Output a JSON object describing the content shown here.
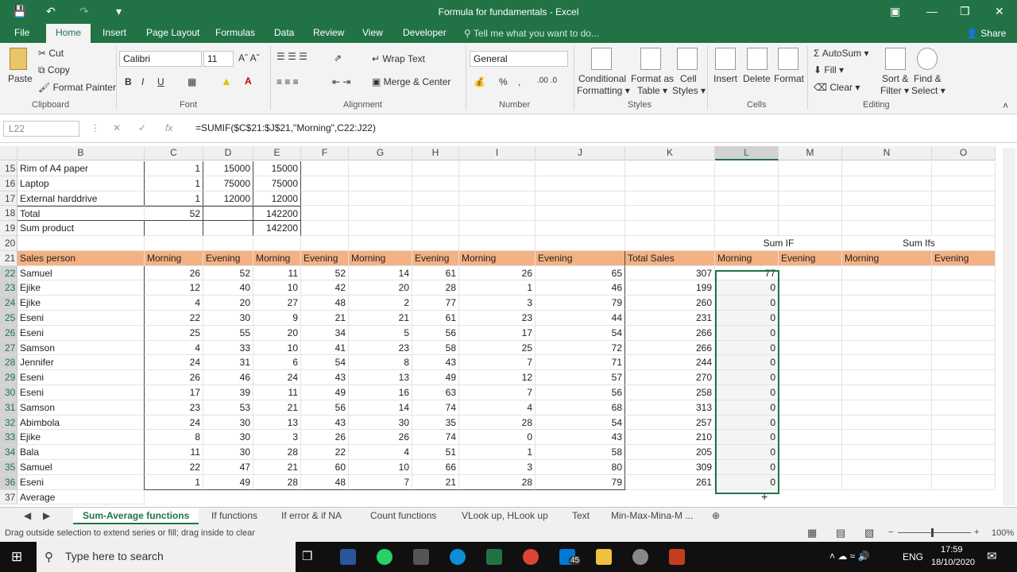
{
  "window": {
    "title": "Formula for fundamentals - Excel"
  },
  "ribbon_tabs": [
    "File",
    "Home",
    "Insert",
    "Page Layout",
    "Formulas",
    "Data",
    "Review",
    "View",
    "Developer"
  ],
  "active_tab": "Home",
  "tellme": "Tell me what you want to do...",
  "share": "Share",
  "clipboard": {
    "paste": "Paste",
    "cut": "Cut",
    "copy": "Copy",
    "format_painter": "Format Painter",
    "label": "Clipboard"
  },
  "font": {
    "name": "Calibri",
    "size": "11",
    "label": "Font"
  },
  "alignment": {
    "wrap": "Wrap Text",
    "merge": "Merge & Center",
    "label": "Alignment"
  },
  "number": {
    "format": "General",
    "label": "Number"
  },
  "styles": {
    "cond": "Conditional",
    "cond2": "Formatting",
    "fmt_table": "Format as",
    "fmt_table2": "Table",
    "cell_styles": "Cell",
    "cell_styles2": "Styles",
    "label": "Styles"
  },
  "cells": {
    "insert": "Insert",
    "delete": "Delete",
    "format": "Format",
    "label": "Cells"
  },
  "editing": {
    "autosum": "AutoSum",
    "fill": "Fill",
    "clear": "Clear",
    "sort": "Sort &",
    "sort2": "Filter",
    "find": "Find &",
    "find2": "Select",
    "label": "Editing"
  },
  "namebox": "L22",
  "formula": "=SUMIF($C$21:$J$21,\"Morning\",C22:J22)",
  "columns": [
    "B",
    "C",
    "D",
    "E",
    "F",
    "G",
    "H",
    "I",
    "J",
    "K",
    "L",
    "M",
    "N",
    "O"
  ],
  "rows": {
    "r15": {
      "num": "15",
      "b": "Rim of A4 paper",
      "c": "1",
      "d": "15000",
      "e": "15000"
    },
    "r16": {
      "num": "16",
      "b": "Laptop",
      "c": "1",
      "d": "75000",
      "e": "75000"
    },
    "r17": {
      "num": "17",
      "b": "External harddrive",
      "c": "1",
      "d": "12000",
      "e": "12000"
    },
    "r18": {
      "num": "18",
      "b": "Total",
      "c": "52",
      "e": "142200"
    },
    "r19": {
      "num": "19",
      "b": "Sum product",
      "e": "142200"
    },
    "r20": {
      "num": "20",
      "l": "Sum IF",
      "n": "Sum Ifs"
    },
    "r21": {
      "num": "21",
      "b": "Sales person",
      "c": "Morning",
      "d": "Evening",
      "e": "Morning",
      "f": "Evening",
      "g": "Morning",
      "h": "Evening",
      "i": "Morning",
      "j": "Evening",
      "k": "Total Sales",
      "l": "Morning",
      "m": "Evening",
      "n": "Morning",
      "o": "Evening"
    }
  },
  "data_rows": [
    {
      "num": "22",
      "name": "Samuel",
      "v": [
        "26",
        "52",
        "11",
        "52",
        "14",
        "61",
        "26",
        "65"
      ],
      "k": "307",
      "l": "77"
    },
    {
      "num": "23",
      "name": "Ejike",
      "v": [
        "12",
        "40",
        "10",
        "42",
        "20",
        "28",
        "1",
        "46"
      ],
      "k": "199",
      "l": "0"
    },
    {
      "num": "24",
      "name": "Ejike",
      "v": [
        "4",
        "20",
        "27",
        "48",
        "2",
        "77",
        "3",
        "79"
      ],
      "k": "260",
      "l": "0"
    },
    {
      "num": "25",
      "name": "Eseni",
      "v": [
        "22",
        "30",
        "9",
        "21",
        "21",
        "61",
        "23",
        "44"
      ],
      "k": "231",
      "l": "0"
    },
    {
      "num": "26",
      "name": "Eseni",
      "v": [
        "25",
        "55",
        "20",
        "34",
        "5",
        "56",
        "17",
        "54"
      ],
      "k": "266",
      "l": "0"
    },
    {
      "num": "27",
      "name": "Samson",
      "v": [
        "4",
        "33",
        "10",
        "41",
        "23",
        "58",
        "25",
        "72"
      ],
      "k": "266",
      "l": "0"
    },
    {
      "num": "28",
      "name": "Jennifer",
      "v": [
        "24",
        "31",
        "6",
        "54",
        "8",
        "43",
        "7",
        "71"
      ],
      "k": "244",
      "l": "0"
    },
    {
      "num": "29",
      "name": "Eseni",
      "v": [
        "26",
        "46",
        "24",
        "43",
        "13",
        "49",
        "12",
        "57"
      ],
      "k": "270",
      "l": "0"
    },
    {
      "num": "30",
      "name": "Eseni",
      "v": [
        "17",
        "39",
        "11",
        "49",
        "16",
        "63",
        "7",
        "56"
      ],
      "k": "258",
      "l": "0"
    },
    {
      "num": "31",
      "name": "Samson",
      "v": [
        "23",
        "53",
        "21",
        "56",
        "14",
        "74",
        "4",
        "68"
      ],
      "k": "313",
      "l": "0"
    },
    {
      "num": "32",
      "name": "Abimbola",
      "v": [
        "24",
        "30",
        "13",
        "43",
        "30",
        "35",
        "28",
        "54"
      ],
      "k": "257",
      "l": "0"
    },
    {
      "num": "33",
      "name": "Ejike",
      "v": [
        "8",
        "30",
        "3",
        "26",
        "26",
        "74",
        "0",
        "43"
      ],
      "k": "210",
      "l": "0"
    },
    {
      "num": "34",
      "name": "Bala",
      "v": [
        "11",
        "30",
        "28",
        "22",
        "4",
        "51",
        "1",
        "58"
      ],
      "k": "205",
      "l": "0"
    },
    {
      "num": "35",
      "name": "Samuel",
      "v": [
        "22",
        "47",
        "21",
        "60",
        "10",
        "66",
        "3",
        "80"
      ],
      "k": "309",
      "l": "0"
    },
    {
      "num": "36",
      "name": "Eseni",
      "v": [
        "1",
        "49",
        "28",
        "48",
        "7",
        "21",
        "28",
        "79"
      ],
      "k": "261",
      "l": "0"
    }
  ],
  "row37": {
    "num": "37",
    "b": "Average"
  },
  "sheets": [
    "Sum-Average functions",
    "If functions",
    "If error & if NA",
    "Count functions",
    "VLook up, HLook up",
    "Text",
    "Min-Max-Mina-M ..."
  ],
  "status": "Drag outside selection to extend series or fill; drag inside to clear",
  "zoom": "100%",
  "taskbar": {
    "search": "Type here to search",
    "lang": "ENG",
    "time": "17:59",
    "date": "18/10/2020",
    "mail_badge": "45"
  }
}
